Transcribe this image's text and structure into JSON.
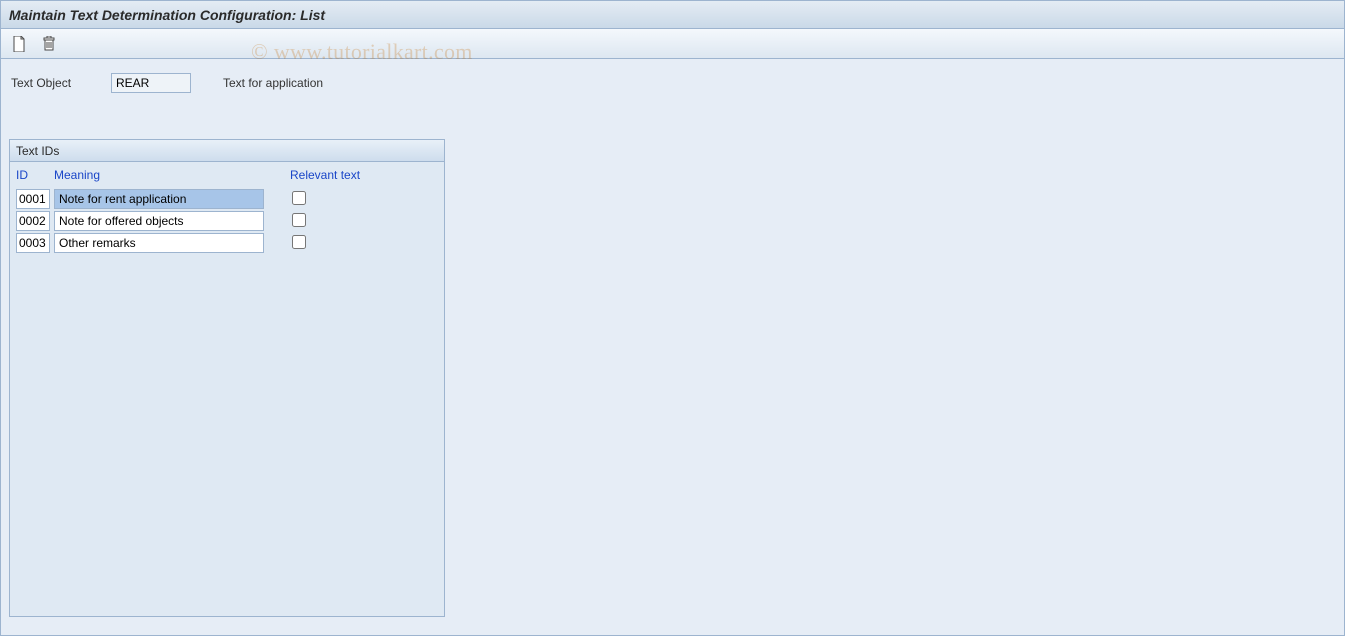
{
  "title": "Maintain Text Determination Configuration: List",
  "toolbar": {
    "new_icon": "document-icon",
    "delete_icon": "trash-icon"
  },
  "meta": {
    "label": "Text Object",
    "value": "REAR",
    "description": "Text for application"
  },
  "panel": {
    "header": "Text IDs",
    "columns": {
      "id": "ID",
      "meaning": "Meaning",
      "relevant": "Relevant text"
    },
    "rows": [
      {
        "id": "0001",
        "meaning": "Note for rent application",
        "relevant": false,
        "selected": true
      },
      {
        "id": "0002",
        "meaning": "Note for offered objects",
        "relevant": false,
        "selected": false
      },
      {
        "id": "0003",
        "meaning": "Other remarks",
        "relevant": false,
        "selected": false
      }
    ]
  },
  "watermark": "© www.tutorialkart.com"
}
